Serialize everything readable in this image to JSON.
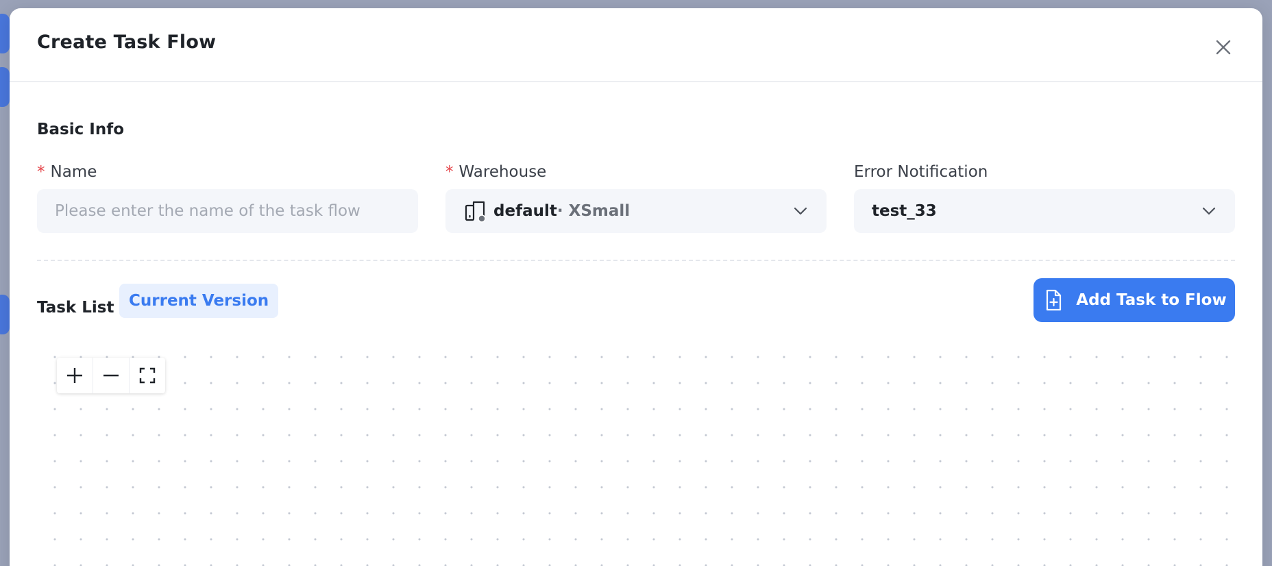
{
  "dialog": {
    "title": "Create Task Flow",
    "close_icon": "close-icon"
  },
  "basic_info": {
    "section_title": "Basic Info",
    "name": {
      "label": "Name",
      "required_mark": "*",
      "placeholder": "Please enter the name of the task flow",
      "value": ""
    },
    "warehouse": {
      "label": "Warehouse",
      "required_mark": "*",
      "value": "default",
      "size": "· XSmall",
      "icon": "warehouse-icon"
    },
    "error_notification": {
      "label": "Error Notification",
      "value": "test_33"
    }
  },
  "task_list": {
    "label": "Task List",
    "version_badge": "Current Version",
    "add_button_label": "Add Task to Flow",
    "add_button_icon": "add-file-icon"
  },
  "canvas_controls": {
    "zoom_in_icon": "plus-icon",
    "zoom_out_icon": "minus-icon",
    "fit_icon": "fullscreen-icon"
  },
  "colors": {
    "primary": "#3a7bf0",
    "required": "#e5484d",
    "badge_bg": "#e8f0fe",
    "input_bg": "#f4f6fa"
  }
}
